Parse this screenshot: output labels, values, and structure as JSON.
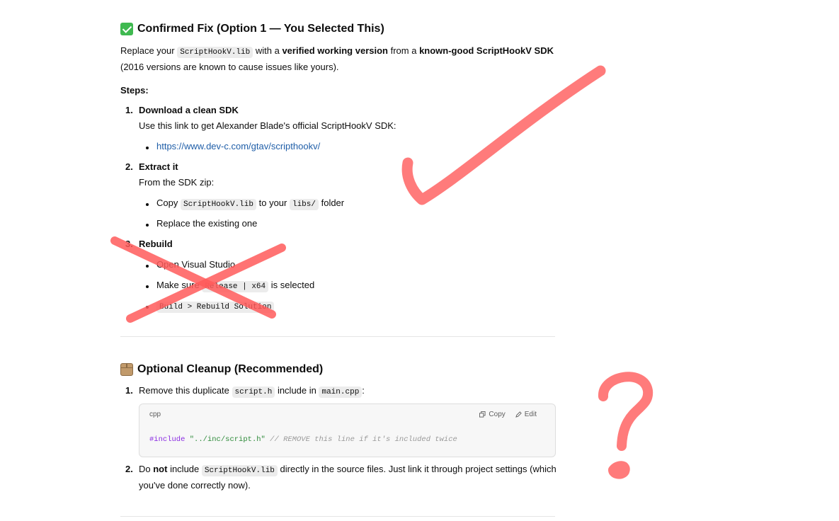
{
  "section1": {
    "title": "Confirmed Fix (Option 1 — You Selected This)",
    "intro": {
      "t1": "Replace your ",
      "c1": "ScriptHookV.lib",
      "t2": " with a ",
      "b1": "verified working version",
      "t3": " from a ",
      "b2": "known-good ScriptHookV SDK",
      "line2": "(2016 versions are known to cause issues like yours)."
    },
    "steps_label": "Steps:",
    "steps": [
      {
        "num": "1.",
        "title": "Download a clean SDK",
        "desc": "Use this link to get Alexander Blade's official ScriptHookV SDK:",
        "link": "https://www.dev-c.com/gtav/scripthookv/"
      },
      {
        "num": "2.",
        "title": "Extract it",
        "desc": "From the SDK zip:",
        "b1_t1": "Copy ",
        "b1_c1": "ScriptHookV.lib",
        "b1_t2": " to your ",
        "b1_c2": "libs/",
        "b1_t3": " folder",
        "b2": "Replace the existing one"
      },
      {
        "num": "3.",
        "title": "Rebuild",
        "b1": "Open Visual Studio",
        "b2_t1": "Make sure ",
        "b2_c1": "Release | x64",
        "b2_t2": " is selected",
        "b3_c1": "Build > Rebuild Solution"
      }
    ]
  },
  "section2": {
    "title": "Optional Cleanup (Recommended)",
    "items": [
      {
        "num": "1.",
        "t1": "Remove this duplicate ",
        "c1": "script.h",
        "t2": " include in ",
        "c2": "main.cpp",
        "t3": ":"
      },
      {
        "num": "2.",
        "t1": "Do ",
        "b1": "not",
        "t2": " include ",
        "c1": "ScriptHookV.lib",
        "t3": " directly in the source files. Just link it through project settings (which",
        "line2": "you've done correctly now)."
      }
    ],
    "codeblock": {
      "lang": "cpp",
      "copy_label": "Copy",
      "edit_label": "Edit",
      "code_kw": "#include",
      "code_str": "\"../inc/script.h\"",
      "code_cmt": "// REMOVE this line if it's included twice"
    }
  },
  "colors": {
    "annotation": "#ff7b7b",
    "x_mark": "#ff5a5a",
    "link": "#1f5ea8"
  }
}
